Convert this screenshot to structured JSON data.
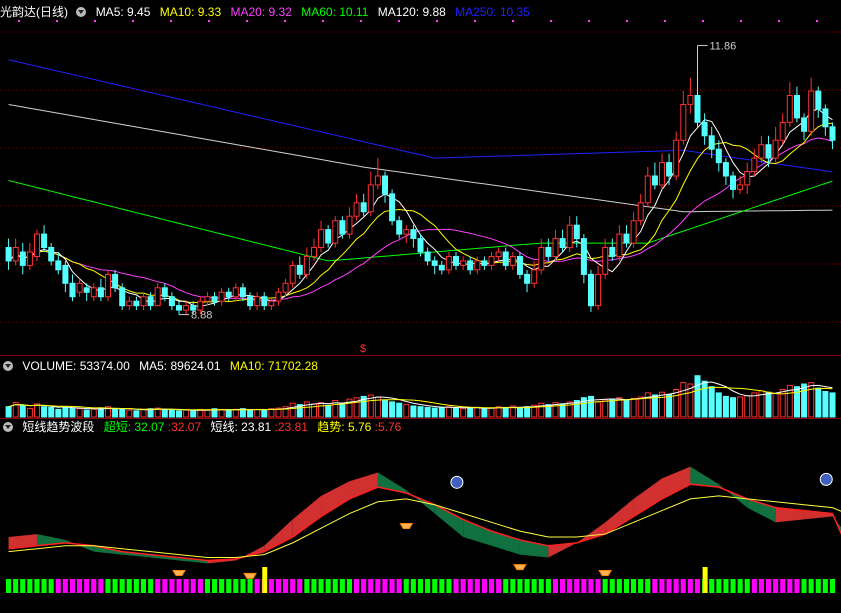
{
  "header": {
    "title": "光韵达(日线)",
    "ma": [
      {
        "label": "MA5:",
        "value": "9.45",
        "color": "#ffffff"
      },
      {
        "label": "MA10:",
        "value": "9.33",
        "color": "#ffff00"
      },
      {
        "label": "MA20:",
        "value": "9.32",
        "color": "#ff40ff"
      },
      {
        "label": "MA60:",
        "value": "10.11",
        "color": "#00ff00"
      },
      {
        "label": "MA120:",
        "value": "9.88",
        "color": "#ffffff"
      },
      {
        "label": "MA250:",
        "value": "10.35",
        "color": "#2020ff"
      }
    ]
  },
  "volume_legend": {
    "title": "VOLUME:",
    "value": "53374.00",
    "ma5_label": "MA5:",
    "ma5_value": "89624.01",
    "ma10_label": "MA10:",
    "ma10_value": "71702.28"
  },
  "indicator_legend": {
    "title": "短线趋势波段",
    "chao_label": "超短:",
    "chao_v1": "32.07",
    "chao_v2": ":32.07",
    "duan_label": "短线:",
    "duan_v1": "23.81",
    "duan_v2": ":23.81",
    "qushi_label": "趋势:",
    "qushi_v1": "5.76",
    "qushi_v2": ":5.76"
  },
  "chart_data": [
    {
      "type": "candlestick",
      "title": "光韵达(日线)",
      "annotations": {
        "high": "11.86",
        "low": "8.88",
        "marker": "$"
      },
      "ylim": [
        8.7,
        12.1
      ],
      "candles": [
        [
          9.6,
          9.45,
          9.7,
          9.35
        ],
        [
          9.45,
          9.6,
          9.7,
          9.4
        ],
        [
          9.55,
          9.4,
          9.65,
          9.3
        ],
        [
          9.4,
          9.55,
          9.65,
          9.35
        ],
        [
          9.5,
          9.75,
          9.8,
          9.45
        ],
        [
          9.75,
          9.6,
          9.85,
          9.55
        ],
        [
          9.6,
          9.45,
          9.65,
          9.4
        ],
        [
          9.45,
          9.35,
          9.55,
          9.3
        ],
        [
          9.4,
          9.2,
          9.45,
          9.1
        ],
        [
          9.2,
          9.05,
          9.3,
          9.0
        ],
        [
          9.1,
          9.2,
          9.25,
          9.05
        ],
        [
          9.15,
          9.1,
          9.2,
          9.0
        ],
        [
          9.05,
          9.15,
          9.2,
          9.0
        ],
        [
          9.15,
          9.05,
          9.25,
          9.0
        ],
        [
          9.05,
          9.3,
          9.35,
          9.0
        ],
        [
          9.3,
          9.15,
          9.35,
          9.1
        ],
        [
          9.15,
          8.95,
          9.2,
          8.9
        ],
        [
          8.95,
          9.0,
          9.05,
          8.9
        ],
        [
          9.0,
          8.95,
          9.05,
          8.9
        ],
        [
          8.95,
          9.05,
          9.1,
          8.9
        ],
        [
          9.05,
          8.95,
          9.1,
          8.9
        ],
        [
          8.95,
          9.15,
          9.2,
          8.95
        ],
        [
          9.15,
          9.05,
          9.2,
          9.0
        ],
        [
          9.05,
          8.95,
          9.1,
          8.9
        ],
        [
          8.95,
          8.9,
          9.0,
          8.85
        ],
        [
          8.9,
          8.95,
          9.0,
          8.85
        ],
        [
          8.95,
          8.9,
          9.0,
          8.85
        ],
        [
          8.9,
          9.0,
          9.05,
          8.85
        ],
        [
          9.0,
          9.05,
          9.1,
          8.95
        ],
        [
          9.05,
          9.0,
          9.1,
          8.95
        ],
        [
          9.0,
          9.1,
          9.15,
          8.95
        ],
        [
          9.1,
          9.05,
          9.15,
          9.0
        ],
        [
          9.05,
          9.15,
          9.2,
          9.0
        ],
        [
          9.15,
          9.05,
          9.2,
          9.0
        ],
        [
          9.05,
          8.95,
          9.1,
          8.9
        ],
        [
          8.95,
          9.05,
          9.1,
          8.9
        ],
        [
          9.05,
          8.95,
          9.1,
          8.9
        ],
        [
          8.95,
          9.0,
          9.05,
          8.9
        ],
        [
          9.0,
          9.1,
          9.15,
          8.95
        ],
        [
          9.1,
          9.2,
          9.25,
          9.05
        ],
        [
          9.2,
          9.4,
          9.45,
          9.15
        ],
        [
          9.4,
          9.3,
          9.5,
          9.25
        ],
        [
          9.3,
          9.5,
          9.6,
          9.25
        ],
        [
          9.5,
          9.6,
          9.7,
          9.45
        ],
        [
          9.6,
          9.8,
          9.9,
          9.55
        ],
        [
          9.8,
          9.65,
          9.85,
          9.6
        ],
        [
          9.65,
          9.9,
          9.95,
          9.6
        ],
        [
          9.9,
          9.75,
          9.95,
          9.7
        ],
        [
          9.75,
          9.95,
          10.05,
          9.7
        ],
        [
          9.95,
          10.1,
          10.2,
          9.9
        ],
        [
          10.1,
          10.0,
          10.2,
          9.95
        ],
        [
          10.0,
          10.3,
          10.45,
          9.95
        ],
        [
          10.3,
          10.4,
          10.6,
          10.25
        ],
        [
          10.4,
          10.2,
          10.45,
          10.1
        ],
        [
          10.2,
          9.9,
          10.25,
          9.85
        ],
        [
          9.9,
          9.75,
          9.95,
          9.7
        ],
        [
          9.75,
          9.8,
          9.85,
          9.65
        ],
        [
          9.8,
          9.7,
          9.85,
          9.6
        ],
        [
          9.7,
          9.55,
          9.75,
          9.5
        ],
        [
          9.55,
          9.45,
          9.6,
          9.4
        ],
        [
          9.45,
          9.4,
          9.5,
          9.3
        ],
        [
          9.4,
          9.35,
          9.45,
          9.3
        ],
        [
          9.35,
          9.5,
          9.55,
          9.3
        ],
        [
          9.5,
          9.4,
          9.55,
          9.35
        ],
        [
          9.4,
          9.45,
          9.5,
          9.35
        ],
        [
          9.45,
          9.35,
          9.5,
          9.3
        ],
        [
          9.35,
          9.45,
          9.5,
          9.3
        ],
        [
          9.45,
          9.4,
          9.5,
          9.35
        ],
        [
          9.4,
          9.5,
          9.55,
          9.35
        ],
        [
          9.5,
          9.55,
          9.6,
          9.45
        ],
        [
          9.55,
          9.4,
          9.6,
          9.35
        ],
        [
          9.4,
          9.5,
          9.55,
          9.35
        ],
        [
          9.5,
          9.3,
          9.55,
          9.25
        ],
        [
          9.3,
          9.2,
          9.35,
          9.1
        ],
        [
          9.2,
          9.35,
          9.45,
          9.15
        ],
        [
          9.35,
          9.6,
          9.7,
          9.3
        ],
        [
          9.6,
          9.5,
          9.7,
          9.45
        ],
        [
          9.5,
          9.7,
          9.8,
          9.45
        ],
        [
          9.7,
          9.6,
          9.8,
          9.55
        ],
        [
          9.6,
          9.85,
          9.95,
          9.55
        ],
        [
          9.85,
          9.7,
          9.95,
          9.6
        ],
        [
          9.7,
          9.3,
          9.75,
          9.2
        ],
        [
          9.3,
          8.95,
          9.35,
          8.88
        ],
        [
          8.95,
          9.3,
          9.4,
          8.9
        ],
        [
          9.3,
          9.6,
          9.7,
          9.25
        ],
        [
          9.6,
          9.5,
          9.7,
          9.45
        ],
        [
          9.5,
          9.75,
          9.85,
          9.45
        ],
        [
          9.75,
          9.65,
          9.85,
          9.6
        ],
        [
          9.65,
          9.9,
          10.0,
          9.6
        ],
        [
          9.9,
          10.1,
          10.2,
          9.85
        ],
        [
          10.1,
          10.4,
          10.5,
          10.05
        ],
        [
          10.4,
          10.3,
          10.55,
          10.25
        ],
        [
          10.3,
          10.55,
          10.65,
          10.25
        ],
        [
          10.55,
          10.4,
          10.65,
          10.3
        ],
        [
          10.4,
          10.8,
          10.9,
          10.35
        ],
        [
          10.8,
          11.2,
          11.35,
          10.75
        ],
        [
          11.2,
          11.3,
          11.5,
          11.1
        ],
        [
          11.3,
          11.0,
          11.86,
          10.95
        ],
        [
          11.0,
          10.85,
          11.1,
          10.75
        ],
        [
          10.85,
          10.7,
          10.95,
          10.6
        ],
        [
          10.7,
          10.55,
          10.8,
          10.45
        ],
        [
          10.55,
          10.4,
          10.6,
          10.3
        ],
        [
          10.4,
          10.25,
          10.45,
          10.15
        ],
        [
          10.25,
          10.3,
          10.4,
          10.2
        ],
        [
          10.3,
          10.45,
          10.55,
          10.2
        ],
        [
          10.45,
          10.6,
          10.7,
          10.4
        ],
        [
          10.6,
          10.75,
          10.85,
          10.55
        ],
        [
          10.75,
          10.6,
          10.85,
          10.5
        ],
        [
          10.6,
          10.8,
          10.95,
          10.55
        ],
        [
          10.8,
          11.0,
          11.1,
          10.75
        ],
        [
          11.0,
          11.3,
          11.45,
          10.95
        ],
        [
          11.3,
          11.05,
          11.4,
          11.0
        ],
        [
          11.05,
          10.9,
          11.1,
          10.8
        ],
        [
          10.9,
          11.35,
          11.5,
          10.85
        ],
        [
          11.35,
          11.15,
          11.4,
          11.05
        ],
        [
          11.15,
          10.95,
          11.2,
          10.85
        ],
        [
          10.95,
          10.8,
          11.0,
          10.7
        ]
      ]
    },
    {
      "type": "bar",
      "title": "VOLUME",
      "values": [
        30,
        42,
        35,
        25,
        38,
        30,
        28,
        22,
        30,
        26,
        24,
        20,
        22,
        26,
        30,
        24,
        22,
        20,
        18,
        22,
        24,
        26,
        22,
        20,
        18,
        20,
        18,
        22,
        20,
        24,
        22,
        20,
        22,
        24,
        20,
        22,
        20,
        24,
        26,
        30,
        40,
        36,
        44,
        38,
        42,
        34,
        48,
        40,
        52,
        56,
        60,
        64,
        58,
        48,
        44,
        40,
        36,
        32,
        30,
        28,
        26,
        28,
        30,
        26,
        24,
        26,
        28,
        24,
        26,
        30,
        28,
        32,
        26,
        30,
        34,
        40,
        36,
        42,
        38,
        44,
        48,
        56,
        60,
        44,
        50,
        52,
        56,
        50,
        54,
        58,
        70,
        64,
        72,
        66,
        80,
        100,
        96,
        120,
        104,
        88,
        70,
        60,
        56,
        58,
        62,
        70,
        76,
        72,
        68,
        80,
        92,
        88,
        96,
        100,
        84,
        74,
        70
      ]
    },
    {
      "type": "area",
      "title": "短线趋势波段",
      "x": [
        0,
        4,
        8,
        12,
        16,
        20,
        24,
        28,
        32,
        36,
        40,
        44,
        48,
        52,
        56,
        60,
        64,
        68,
        72,
        76,
        80,
        84,
        88,
        92,
        96,
        100,
        104,
        108,
        112,
        116,
        118
      ],
      "chao": [
        30,
        32,
        28,
        20,
        18,
        16,
        14,
        12,
        14,
        24,
        42,
        58,
        68,
        74,
        62,
        46,
        30,
        24,
        18,
        16,
        26,
        40,
        56,
        70,
        78,
        66,
        50,
        40,
        42,
        44,
        32
      ],
      "duan": [
        22,
        24,
        26,
        24,
        20,
        18,
        16,
        14,
        15,
        20,
        30,
        44,
        56,
        64,
        60,
        52,
        42,
        34,
        28,
        24,
        26,
        32,
        44,
        56,
        66,
        64,
        56,
        50,
        48,
        46,
        24
      ],
      "qushi": [
        20,
        22,
        24,
        24,
        22,
        20,
        18,
        16,
        16,
        18,
        26,
        36,
        46,
        54,
        56,
        52,
        46,
        40,
        34,
        30,
        30,
        32,
        40,
        48,
        56,
        58,
        56,
        54,
        52,
        50,
        46
      ],
      "bars_color": [
        "#00ff00",
        "#ff00ff"
      ]
    }
  ]
}
